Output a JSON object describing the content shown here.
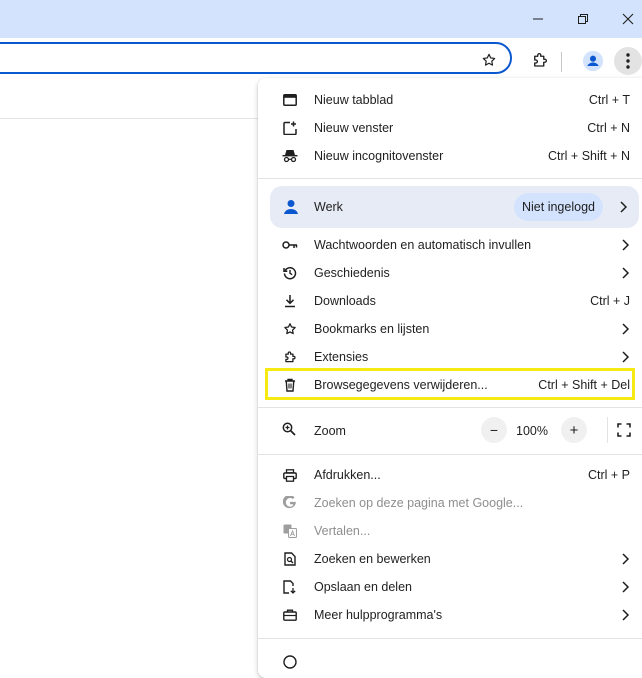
{
  "menu": {
    "group1": [
      {
        "label": "Nieuw tabblad",
        "shortcut": "Ctrl + T"
      },
      {
        "label": "Nieuw venster",
        "shortcut": "Ctrl + N"
      },
      {
        "label": "Nieuw incognitovenster",
        "shortcut": "Ctrl + Shift + N"
      }
    ],
    "profile": {
      "label": "Werk",
      "status": "Niet ingelogd"
    },
    "group2": [
      {
        "label": "Wachtwoorden en automatisch invullen"
      },
      {
        "label": "Geschiedenis"
      },
      {
        "label": "Downloads",
        "shortcut": "Ctrl + J"
      },
      {
        "label": "Bookmarks en lijsten"
      },
      {
        "label": "Extensies"
      },
      {
        "label": "Browsegegevens verwijderen...",
        "shortcut": "Ctrl + Shift + Del"
      }
    ],
    "zoom": {
      "label": "Zoom",
      "value": "100%",
      "minus": "−",
      "plus": "+"
    },
    "group3": [
      {
        "label": "Afdrukken...",
        "shortcut": "Ctrl + P"
      },
      {
        "label": "Zoeken op deze pagina met Google..."
      },
      {
        "label": "Vertalen..."
      },
      {
        "label": "Zoeken en bewerken"
      },
      {
        "label": "Opslaan en delen"
      },
      {
        "label": "Meer hulpprogramma's"
      }
    ]
  },
  "colors": {
    "titlebar": "#d3e3fd",
    "omnibox_border": "#0b57d0",
    "profile_bg": "#e6ebf5",
    "highlight": "#f7ea12"
  },
  "icons": {
    "titlebar": [
      "chevron-down-icon",
      "minimize-icon",
      "restore-icon",
      "close-icon"
    ],
    "toolbar": [
      "star-icon",
      "extensions-icon",
      "profile-icon",
      "more-vert-icon"
    ]
  }
}
